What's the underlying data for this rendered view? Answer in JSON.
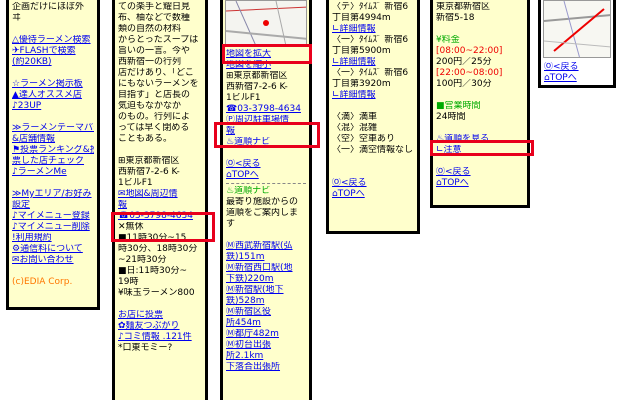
{
  "col1": {
    "lines": [
      {
        "t": "企画だけにほぼ外",
        "cls": ""
      },
      {
        "t": "ヰ",
        "cls": ""
      },
      {
        "t": "",
        "cls": ""
      },
      {
        "t": "△優待ラーメン検索",
        "cls": "lnk"
      },
      {
        "t": "✈FLASHで検索",
        "cls": "lnk"
      },
      {
        "t": "(約20KB)",
        "cls": "lnk"
      },
      {
        "t": "",
        "cls": ""
      },
      {
        "t": "☆ラーメン掲示板",
        "cls": "lnk"
      },
      {
        "t": "▲達人オススメ店",
        "cls": "lnk"
      },
      {
        "t": "♪23UP",
        "cls": "lnk"
      },
      {
        "t": "",
        "cls": ""
      },
      {
        "t": "≫ラーメンテーマパーク",
        "cls": "lnk"
      },
      {
        "t": "&店舗情報",
        "cls": "lnk"
      },
      {
        "t": "⚑投票ランキング&投",
        "cls": "lnk"
      },
      {
        "t": "票した店チェック",
        "cls": "lnk"
      },
      {
        "t": "♪ラーメンMe",
        "cls": "lnk"
      },
      {
        "t": "",
        "cls": ""
      },
      {
        "t": "≫Myエリア/お好み",
        "cls": "lnk"
      },
      {
        "t": "設定",
        "cls": "lnk"
      },
      {
        "t": "♪マイメニュー登録",
        "cls": "lnk"
      },
      {
        "t": "♪マイメニュー削除",
        "cls": "lnk"
      },
      {
        "t": "!利用規約",
        "cls": "lnk"
      },
      {
        "t": "⚙通信料について",
        "cls": "lnk"
      },
      {
        "t": "✉お問い合わせ",
        "cls": "lnk"
      },
      {
        "t": "",
        "cls": ""
      },
      {
        "t": "(c)EDIA Corp.",
        "cls": "orange"
      }
    ]
  },
  "col2": {
    "lines": [
      {
        "t": "ての楽手と耀日見",
        "cls": ""
      },
      {
        "t": "布、柚などで数種",
        "cls": ""
      },
      {
        "t": "類の自然の材料",
        "cls": ""
      },
      {
        "t": "からとったスープは",
        "cls": ""
      },
      {
        "t": "旨いの一言。今や",
        "cls": ""
      },
      {
        "t": "西新宿一の行列",
        "cls": ""
      },
      {
        "t": "店だけあり、「どこ",
        "cls": ""
      },
      {
        "t": "にもないラーメンを",
        "cls": ""
      },
      {
        "t": "目指す」と店長の",
        "cls": ""
      },
      {
        "t": "気迫もなかなか",
        "cls": ""
      },
      {
        "t": "のもの。行列によ",
        "cls": ""
      },
      {
        "t": "っては早く閉める",
        "cls": ""
      },
      {
        "t": "こともある。",
        "cls": ""
      },
      {
        "t": "",
        "cls": ""
      },
      {
        "t": "⊞東京都新宿区",
        "cls": ""
      },
      {
        "t": "西新宿7-2-6 K-",
        "cls": ""
      },
      {
        "t": "1ビルF1",
        "cls": ""
      },
      {
        "t": "✉地図&周辺情",
        "cls": "lnk"
      },
      {
        "t": "報",
        "cls": "lnk"
      },
      {
        "t": "☎03-3798-4634",
        "cls": "lnk"
      },
      {
        "t": "✕無休",
        "cls": ""
      },
      {
        "t": "■11時30分~15",
        "cls": ""
      },
      {
        "t": "時30分、18時30分",
        "cls": ""
      },
      {
        "t": "~21時30分",
        "cls": ""
      },
      {
        "t": "■日:11時30分~",
        "cls": ""
      },
      {
        "t": "19時",
        "cls": ""
      },
      {
        "t": "¥味玉ラーメン800",
        "cls": ""
      },
      {
        "t": "",
        "cls": ""
      },
      {
        "t": "お店に投票",
        "cls": "lnk"
      },
      {
        "t": "✿麺友つぶがり",
        "cls": "lnk"
      },
      {
        "t": "♪コミ情報 .121件",
        "cls": "lnk"
      },
      {
        "t": "*口東モミー?",
        "cls": ""
      }
    ]
  },
  "col3": {
    "lines_top": [
      {
        "t": "地図を拡大",
        "cls": "lnk"
      },
      {
        "t": "地図を縮小",
        "cls": "lnk"
      },
      {
        "t": "⊞東京都新宿区",
        "cls": ""
      },
      {
        "t": "西新宿7-2-6 K-",
        "cls": ""
      },
      {
        "t": "1ビルF1",
        "cls": ""
      },
      {
        "t": "☎03-3798-4634",
        "cls": "lnk"
      },
      {
        "t": "Ⓟ周辺駐車場情",
        "cls": "lnk"
      },
      {
        "t": "報",
        "cls": "lnk"
      },
      {
        "t": "♨道順ナビ",
        "cls": "lnk"
      },
      {
        "t": "",
        "cls": ""
      },
      {
        "t": "Ⓞ<戻る",
        "cls": "lnk"
      },
      {
        "t": "⌂TOPへ",
        "cls": "lnk"
      }
    ],
    "lines_bottom": [
      {
        "t": "♨道順ナビ",
        "cls": "green"
      },
      {
        "t": "最寄り施設からの",
        "cls": ""
      },
      {
        "t": "道順をご案内しま",
        "cls": ""
      },
      {
        "t": "す",
        "cls": ""
      },
      {
        "t": "",
        "cls": ""
      },
      {
        "t": "Ⓜ西武新宿駅(弘",
        "cls": "lnk"
      },
      {
        "t": "鉄)151m",
        "cls": "lnk"
      },
      {
        "t": "Ⓜ新宿西口駅(地",
        "cls": "lnk"
      },
      {
        "t": "下鉄)220m",
        "cls": "lnk"
      },
      {
        "t": "Ⓜ新宿駅(地下",
        "cls": "lnk"
      },
      {
        "t": "鉄)528m",
        "cls": "lnk"
      },
      {
        "t": "Ⓜ新宿区役",
        "cls": "lnk"
      },
      {
        "t": "所454m",
        "cls": "lnk"
      },
      {
        "t": "Ⓜ都庁482m",
        "cls": "lnk"
      },
      {
        "t": "Ⓜ初台出張",
        "cls": "lnk"
      },
      {
        "t": "所2.1km",
        "cls": "lnk"
      },
      {
        "t": "下落合出張所",
        "cls": "lnk"
      }
    ]
  },
  "col4": {
    "lines": [
      {
        "t": "〈テ〉ﾀｲﾑｽﾞ 新宿6",
        "cls": ""
      },
      {
        "t": "丁目第4994m",
        "cls": ""
      },
      {
        "t": " ∟詳細情報",
        "cls": "lnk"
      },
      {
        "t": "〈一〉ﾀｲﾑｽﾞ 新宿6",
        "cls": ""
      },
      {
        "t": "丁目第5900m",
        "cls": ""
      },
      {
        "t": " ∟詳細情報",
        "cls": "lnk"
      },
      {
        "t": "〈一〉ﾀｲﾑｽﾞ 新宿6",
        "cls": ""
      },
      {
        "t": "丁目第3920m",
        "cls": ""
      },
      {
        "t": " ∟詳細情報",
        "cls": "lnk"
      },
      {
        "t": "",
        "cls": ""
      },
      {
        "t": "〈満〉満車",
        "cls": ""
      },
      {
        "t": "〈混〉混雑",
        "cls": ""
      },
      {
        "t": "〈空〉空車あり",
        "cls": ""
      },
      {
        "t": "〈一〉満空情報なし",
        "cls": ""
      },
      {
        "t": "",
        "cls": ""
      },
      {
        "t": "",
        "cls": ""
      },
      {
        "t": "Ⓞ<戻る",
        "cls": "lnk"
      },
      {
        "t": "⌂TOPへ",
        "cls": "lnk"
      }
    ]
  },
  "col5": {
    "lines": [
      {
        "t": "東京都新宿区",
        "cls": ""
      },
      {
        "t": "新宿5-18",
        "cls": ""
      },
      {
        "t": "",
        "cls": ""
      },
      {
        "t": "¥料金",
        "cls": "green"
      },
      {
        "t": "[08:00~22:00]",
        "cls": "red"
      },
      {
        "t": "200円／25分",
        "cls": ""
      },
      {
        "t": "[22:00~08:00]",
        "cls": "red"
      },
      {
        "t": "100円／30分",
        "cls": ""
      },
      {
        "t": "",
        "cls": ""
      },
      {
        "t": "■営業時間",
        "cls": "green"
      },
      {
        "t": "24時間",
        "cls": ""
      },
      {
        "t": "",
        "cls": ""
      },
      {
        "t": "♨道順を見る",
        "cls": "lnk"
      },
      {
        "t": "∟注意",
        "cls": "lnk"
      },
      {
        "t": "",
        "cls": ""
      },
      {
        "t": "Ⓞ<戻る",
        "cls": "lnk"
      },
      {
        "t": "⌂TOPへ",
        "cls": "lnk"
      }
    ]
  },
  "col6": {
    "lines": [
      {
        "t": "Ⓞ<戻る",
        "cls": "lnk"
      },
      {
        "t": "⌂TOPへ",
        "cls": "lnk"
      }
    ]
  },
  "colors": {
    "highlight": "#e8001c",
    "link": "#0000ee",
    "panel": "#ffffcc"
  }
}
